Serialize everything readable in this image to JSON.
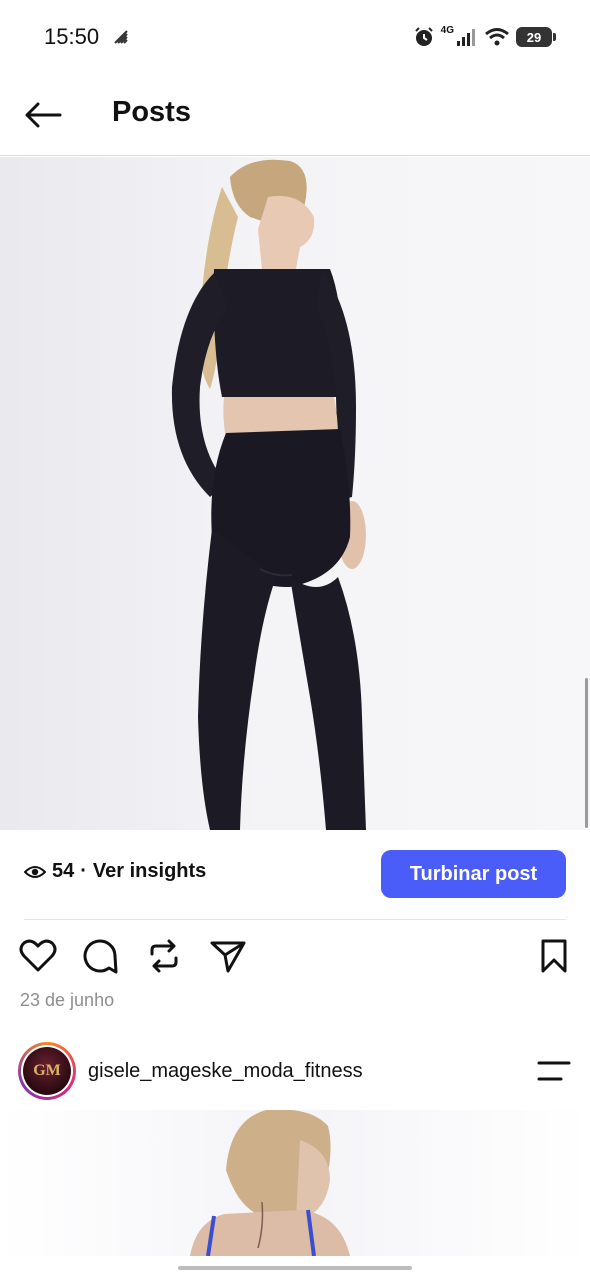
{
  "status_bar": {
    "time": "15:50",
    "network": "4G",
    "battery": "29"
  },
  "header": {
    "title": "Posts"
  },
  "post": {
    "views": "54",
    "separator": "·",
    "insights_label": "Ver insights",
    "boost_label": "Turbinar post",
    "date": "23 de junho"
  },
  "next_post": {
    "username": "gisele_mageske_moda_fitness",
    "avatar_text": "GM"
  },
  "colors": {
    "accent": "#4a5df9",
    "date_text": "#8e8e8e"
  },
  "icons": [
    "back-arrow-icon",
    "eye-icon",
    "heart-icon",
    "comment-icon",
    "repost-icon",
    "share-icon",
    "bookmark-icon",
    "menu-icon",
    "alarm-icon",
    "wifi-icon",
    "signal-icon"
  ]
}
